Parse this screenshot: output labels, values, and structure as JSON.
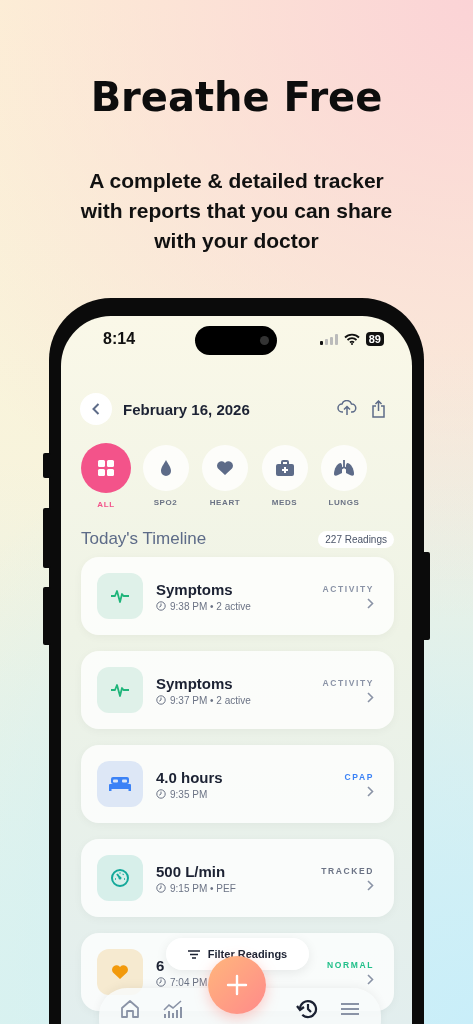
{
  "promo": {
    "headline": "Breathe Free",
    "subtitle": "A complete & detailed tracker with reports that you can share with your doctor"
  },
  "status_bar": {
    "time": "8:14",
    "battery": "89"
  },
  "header": {
    "date": "February 16, 2026"
  },
  "categories": [
    {
      "kind": "all",
      "label": "ALL",
      "selected": true
    },
    {
      "kind": "spo2",
      "label": "SPO2",
      "selected": false
    },
    {
      "kind": "heart",
      "label": "HEART",
      "selected": false
    },
    {
      "kind": "meds",
      "label": "MEDS",
      "selected": false
    },
    {
      "kind": "lungs",
      "label": "LUNGS",
      "selected": false
    }
  ],
  "timeline": {
    "title": "Today's Timeline",
    "count": "227 Readings"
  },
  "readings": [
    {
      "kind": "symptoms",
      "title": "Symptoms",
      "subtitle": "9:38 PM • 2 active",
      "tag": "ACTIVITY",
      "color": "#8a93a6"
    },
    {
      "kind": "symptoms",
      "title": "Symptoms",
      "subtitle": "9:37 PM • 2 active",
      "tag": "ACTIVITY",
      "color": "#8a93a6"
    },
    {
      "kind": "sleep",
      "title": "4.0 hours",
      "subtitle": "9:35 PM",
      "tag": "CPAP",
      "color": "#3b82f6"
    },
    {
      "kind": "flow",
      "title": "500 L/min",
      "subtitle": "9:15 PM • PEF",
      "tag": "TRACKED",
      "color": "#6b7385"
    },
    {
      "kind": "heart",
      "title": "6",
      "subtitle": "7:04 PM",
      "tag": "NORMAL",
      "color": "#22c08a"
    }
  ],
  "filter_button": "Filter Readings",
  "tab_bar": [
    {
      "kind": "home",
      "selected": false
    },
    {
      "kind": "trends",
      "selected": false
    },
    {
      "kind": "history",
      "selected": true
    },
    {
      "kind": "menu",
      "selected": false
    }
  ]
}
